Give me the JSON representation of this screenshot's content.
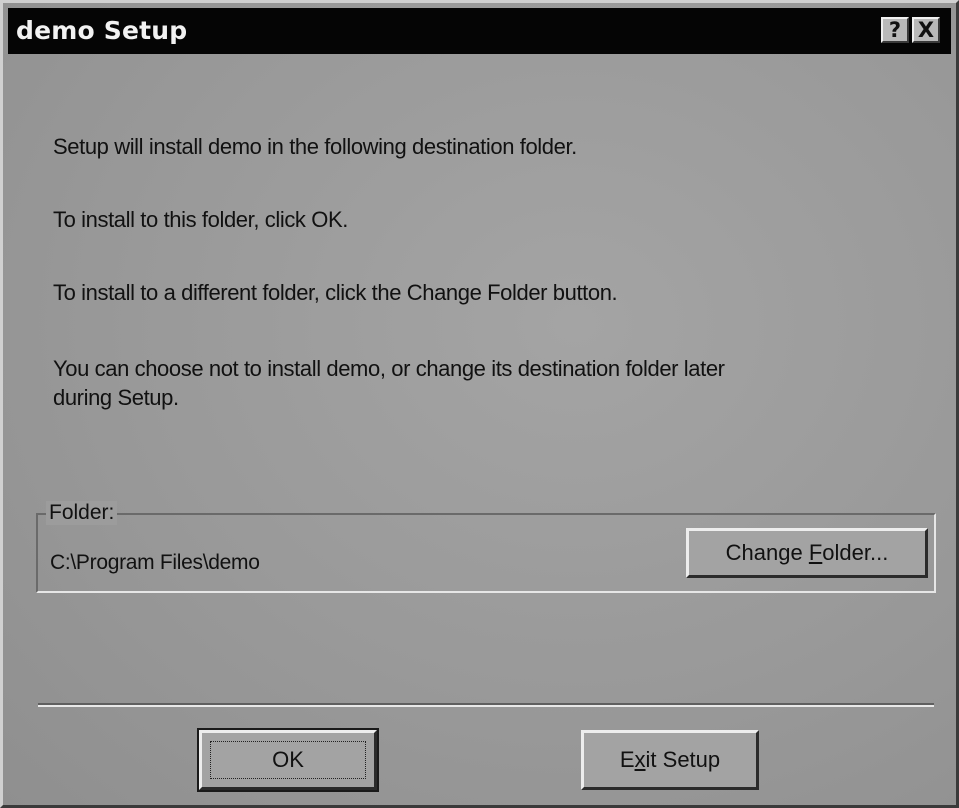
{
  "window": {
    "title": "demo Setup",
    "help_glyph": "?",
    "close_glyph": "X"
  },
  "messages": [
    "Setup will install demo in the following destination folder.",
    "To install to this folder, click OK.",
    "To install to a different folder, click the Change Folder button.",
    "You can choose not to install demo, or change its destination folder later",
    "during Setup."
  ],
  "folder_group": {
    "label": "Folder:",
    "path": "C:\\Program Files\\demo",
    "change_button": {
      "pre": "Change ",
      "accel": "F",
      "post": "older..."
    }
  },
  "buttons": {
    "ok_label": "OK",
    "exit": {
      "pre": "E",
      "accel": "x",
      "post": "it Setup"
    }
  }
}
